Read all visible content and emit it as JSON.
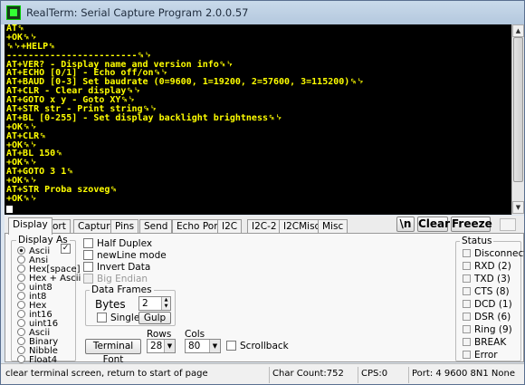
{
  "window": {
    "title": "RealTerm: Serial Capture Program 2.0.0.57",
    "icon": "terminal-app-icon"
  },
  "terminal": {
    "colors": {
      "background": "#000000",
      "text": "#ffff00"
    },
    "lines": [
      "AT␍",
      "+OK␍␊",
      "␍␊+HELP␍",
      "------------------------␍␊",
      "AT+VER? - Display name and version info␍␊",
      "AT+ECHO [0/1] - Echo off/on␍␊",
      "AT+BAUD [0-3] Set baudrate (0=9600, 1=19200, 2=57600, 3=115200)␍␊",
      "AT+CLR - Clear display␍␊",
      "AT+GOTO x y - Goto XY␍␊",
      "AT+STR str - Print string␍␊",
      "AT+BL [0-255] - Set display backlight brightness␍␊",
      "+OK␍␊",
      "AT+CLR␍",
      "+OK␍␊",
      "AT+BL 150␍",
      "+OK␍␊",
      "AT+GOTO 3 1␍",
      "+OK␍␊",
      "AT+STR Proba szoveg␍",
      "+OK␍␊"
    ]
  },
  "tabs": [
    "Display",
    "Port",
    "Capture",
    "Pins",
    "Send",
    "Echo Port",
    "I2C",
    "I2C-2",
    "I2CMisc",
    "Misc"
  ],
  "toolbar": {
    "newline_button": "\\n",
    "clear_button": "Clear",
    "freeze_button": "Freeze"
  },
  "display_as": {
    "title": "Display As",
    "options": [
      "Ascii",
      "Ansi",
      "Hex[space]",
      "Hex + Ascii",
      "uint8",
      "int8",
      "Hex",
      "int16",
      "uint16",
      "Ascii",
      "Binary",
      "Nibble",
      "Float4"
    ],
    "selected": "Ascii"
  },
  "options": {
    "half_duplex": "Half Duplex",
    "newline_mode": "newLine mode",
    "invert_data": "Invert Data",
    "big_endian": "Big Endian"
  },
  "data_frames": {
    "title": "Data Frames",
    "bytes_label": "Bytes",
    "bytes_value": "2",
    "single_label": "Single",
    "gulp_button": "Gulp"
  },
  "terminal_font_button": "Terminal Font",
  "rows": {
    "label": "Rows",
    "value": "28"
  },
  "cols": {
    "label": "Cols",
    "value": "80"
  },
  "scrollback": "Scrollback",
  "status_panel": {
    "title": "Status",
    "items": [
      "Disconnect",
      "RXD (2)",
      "TXD (3)",
      "CTS (8)",
      "DCD (1)",
      "DSR (6)",
      "Ring (9)",
      "BREAK",
      "Error"
    ]
  },
  "statusbar": {
    "hint": "clear terminal screen, return to start of page",
    "char_count": "Char Count:752",
    "cps": "CPS:0",
    "port": "Port: 4 9600 8N1 None"
  }
}
